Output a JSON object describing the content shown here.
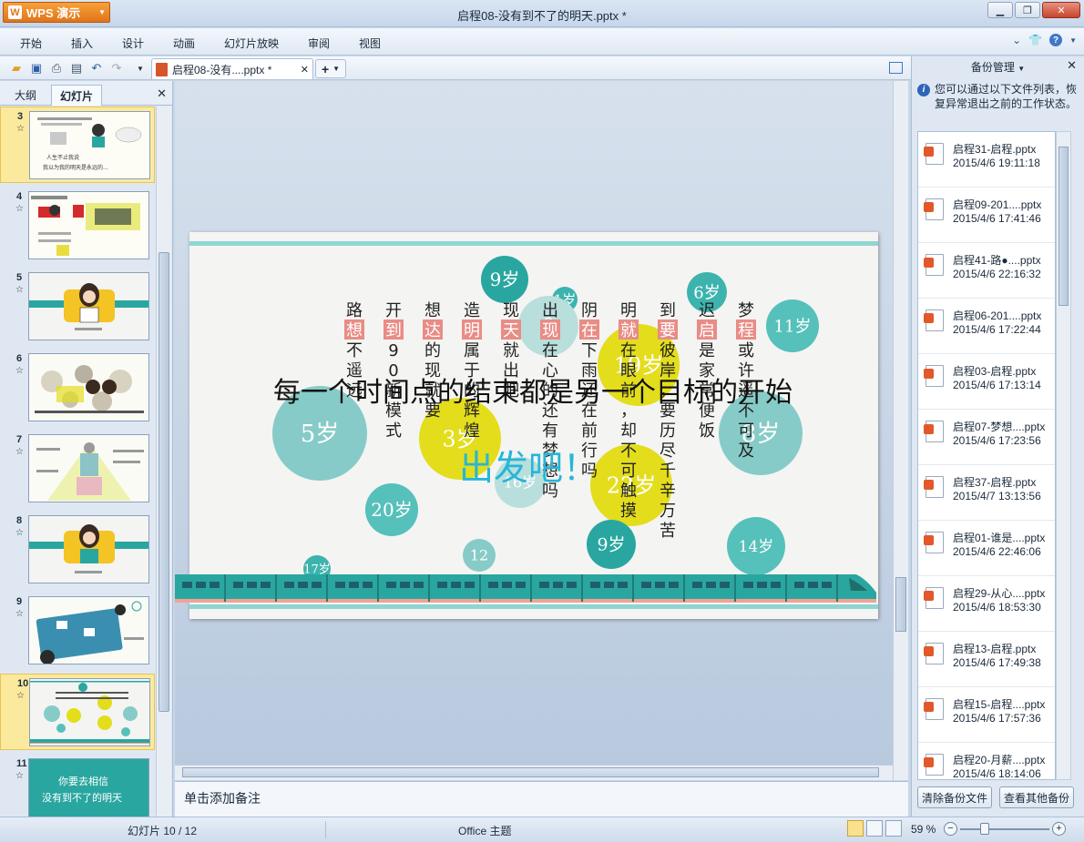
{
  "app": {
    "name": "WPS 演示",
    "logo_letter": "W",
    "window_title": "启程08-没有到不了的明天.pptx *"
  },
  "menu": [
    "开始",
    "插入",
    "设计",
    "动画",
    "幻灯片放映",
    "审阅",
    "视图"
  ],
  "document_tab": {
    "label": "启程08-没有....pptx *"
  },
  "left_panel": {
    "tabs": [
      "大纲",
      "幻灯片"
    ],
    "slides": [
      {
        "number": "3",
        "selected": true
      },
      {
        "number": "4",
        "selected": false
      },
      {
        "number": "5",
        "selected": false
      },
      {
        "number": "6",
        "selected": false
      },
      {
        "number": "7",
        "selected": false
      },
      {
        "number": "8",
        "selected": false
      },
      {
        "number": "9",
        "selected": false
      },
      {
        "number": "10",
        "selected": true
      },
      {
        "number": "11",
        "selected": false
      }
    ],
    "thumb_text": {
      "slide3_line1": "人生不止我说",
      "slide3_line2": "我以为我的明天是永远的…",
      "slide11_line1": "你要去相信",
      "slide11_line2": "没有到不了的明天"
    }
  },
  "slide": {
    "headline": "每一个时间点的结束都是另一个目标的开始",
    "go": "出发吧！",
    "bubbles": [
      {
        "label": "9岁",
        "color": "#2aa6a0"
      },
      {
        "label": "1岁",
        "color": "#3db3ad"
      },
      {
        "label": "6岁",
        "color": "#3db3ad"
      },
      {
        "label": "11岁",
        "color": "#56c0bb"
      },
      {
        "label": "0",
        "color": "#b9dfdc"
      },
      {
        "label": "19岁",
        "color": "#e3dd1c"
      },
      {
        "label": "5岁",
        "color": "#86cbc7"
      },
      {
        "label": "8岁",
        "color": "#86cbc7"
      },
      {
        "label": "3岁",
        "color": "#e3dd1c"
      },
      {
        "label": "16岁",
        "color": "#b9dfdc"
      },
      {
        "label": "22岁",
        "color": "#e3dd1c"
      },
      {
        "label": "20岁",
        "color": "#56c0bb"
      },
      {
        "label": "9岁",
        "color": "#2aa6a0"
      },
      {
        "label": "14岁",
        "color": "#56c0bb"
      },
      {
        "label": "12",
        "color": "#86cbc7"
      },
      {
        "label": "17岁",
        "color": "#3db3ad"
      }
    ],
    "columns": [
      {
        "top": "路",
        "highlight": "想",
        "rest": "不遥远"
      },
      {
        "top": "开",
        "highlight": "到",
        "rest": "90新模式"
      },
      {
        "top": "想",
        "highlight": "达",
        "rest": "的现就要"
      },
      {
        "top": "造",
        "highlight": "明",
        "rest": "属于的辉煌"
      },
      {
        "top": "现",
        "highlight": "天",
        "rest": "就出吧"
      },
      {
        "top": "出",
        "highlight": "现",
        "rest": "在心的还有梦想吗"
      },
      {
        "top": "阴",
        "highlight": "在",
        "rest": "下雨还在前行吗"
      },
      {
        "top": "明",
        "highlight": "就",
        "rest": "在眼前，却不可触摸"
      },
      {
        "top": "到",
        "highlight": "要",
        "rest": "彼岸，要历尽千辛万苦"
      },
      {
        "top": "迟",
        "highlight": "启",
        "rest": "是家常便饭"
      },
      {
        "top": "梦",
        "highlight": "程",
        "rest": "或许遥不可及"
      }
    ],
    "colors": {
      "teal": "#2aa6a0",
      "highlight": "#e98c86",
      "yellow": "#e3dd1c",
      "train_band": "#f3a393"
    }
  },
  "notes": {
    "placeholder": "单击添加备注"
  },
  "right_panel": {
    "title": "备份管理",
    "info": "您可以通过以下文件列表，恢复异常退出之前的工作状态。",
    "backups": [
      {
        "name": "启程31-启程.pptx",
        "time": "2015/4/6 19:11:18"
      },
      {
        "name": "启程09-201....pptx",
        "time": "2015/4/6 17:41:46"
      },
      {
        "name": "启程41-路●....pptx",
        "time": "2015/4/6 22:16:32"
      },
      {
        "name": "启程06-201....pptx",
        "time": "2015/4/6 17:22:44"
      },
      {
        "name": "启程03-启程.pptx",
        "time": "2015/4/6 17:13:14"
      },
      {
        "name": "启程07-梦想....pptx",
        "time": "2015/4/6 17:23:56"
      },
      {
        "name": "启程37-启程.pptx",
        "time": "2015/4/7 13:13:56"
      },
      {
        "name": "启程01-谁是....pptx",
        "time": "2015/4/6 22:46:06"
      },
      {
        "name": "启程29-从心....pptx",
        "time": "2015/4/6 18:53:30"
      },
      {
        "name": "启程13-启程.pptx",
        "time": "2015/4/6 17:49:38"
      },
      {
        "name": "启程15-启程....pptx",
        "time": "2015/4/6 17:57:36"
      },
      {
        "name": "启程20-月薪....pptx",
        "time": "2015/4/6 18:14:06"
      }
    ],
    "clear_button": "清除备份文件",
    "view_button": "查看其他备份"
  },
  "status": {
    "slide_info": "幻灯片 10 / 12",
    "theme": "Office 主题",
    "zoom": "59 %"
  }
}
